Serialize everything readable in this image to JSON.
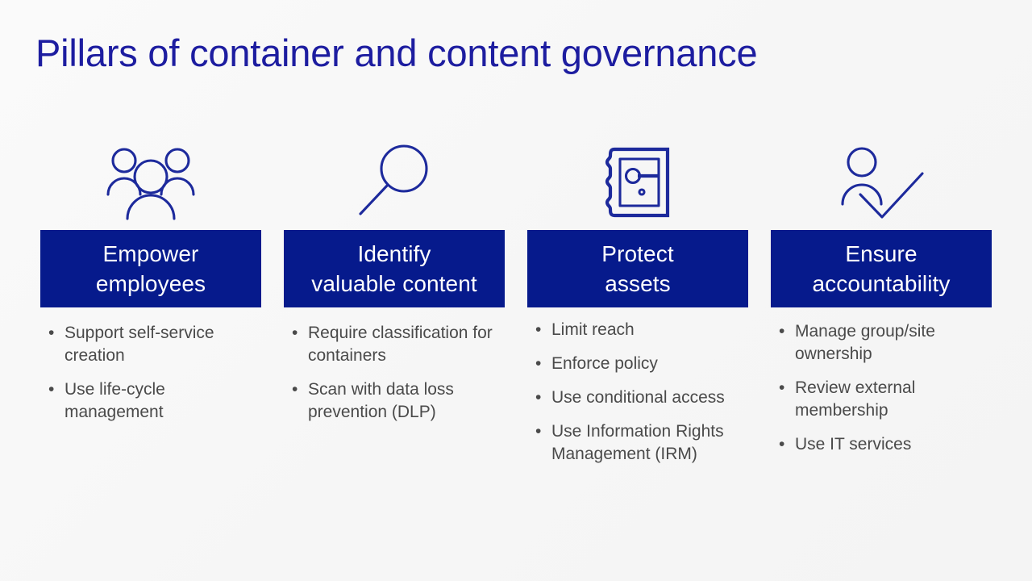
{
  "slide": {
    "title": "Pillars of container and content governance",
    "background_color": "#f7f7f7",
    "accent_color": "#061a8c",
    "title_color": "#1d1da0",
    "body_text_color": "#4a4a4a",
    "bullet_glyph": "•"
  },
  "columns": [
    {
      "icon": "people-group-icon",
      "header_line1": "Empower",
      "header_line2": "employees",
      "bullets": [
        "Support self-service creation",
        "Use life-cycle management"
      ]
    },
    {
      "icon": "magnifying-glass-icon",
      "header_line1": "Identify",
      "header_line2": "valuable  content",
      "bullets": [
        "Require classification for containers",
        "Scan with data loss prevention (DLP)"
      ]
    },
    {
      "icon": "safe-vault-icon",
      "header_line1": "Protect",
      "header_line2": "assets",
      "bullets": [
        "Limit reach",
        "Enforce policy",
        "Use conditional access",
        "Use Information Rights Management (IRM)"
      ]
    },
    {
      "icon": "person-check-icon",
      "header_line1": "Ensure",
      "header_line2": "accountability",
      "bullets": [
        "Manage group/site ownership",
        "Review external membership",
        "Use IT services"
      ]
    }
  ]
}
